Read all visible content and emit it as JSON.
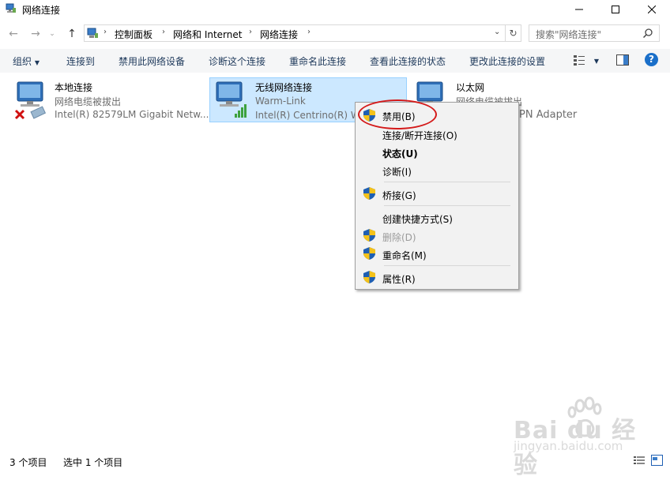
{
  "window": {
    "title": "网络连接"
  },
  "address": {
    "crumbs": [
      "控制面板",
      "网络和 Internet",
      "网络连接"
    ],
    "search_placeholder": "搜索\"网络连接\""
  },
  "toolbar": {
    "organize": "组织",
    "connect_to": "连接到",
    "disable_device": "禁用此网络设备",
    "diagnose": "诊断这个连接",
    "rename": "重命名此连接",
    "view_status": "查看此连接的状态",
    "change_settings": "更改此连接的设置"
  },
  "connections": [
    {
      "name": "本地连接",
      "status": "网络电缆被拔出",
      "adapter": "Intel(R) 82579LM Gigabit Netw..."
    },
    {
      "name": "无线网络连接",
      "status": "Warm-Link",
      "adapter": "Intel(R) Centrino(R) W"
    },
    {
      "name": "以太网",
      "status": "网络电缆被拔出",
      "adapter": "PN Adapter"
    }
  ],
  "context_menu": {
    "disable": "禁用(B)",
    "connect_disconnect": "连接/断开连接(O)",
    "status": "状态(U)",
    "diagnose": "诊断(I)",
    "bridge": "桥接(G)",
    "create_shortcut": "创建快捷方式(S)",
    "delete": "删除(D)",
    "rename": "重命名(M)",
    "properties": "属性(R)"
  },
  "statusbar": {
    "count": "3 个项目",
    "selected": "选中 1 个项目"
  },
  "watermark": {
    "brand": "Bai du 经验",
    "url": "jingyan.baidu.com"
  },
  "colors": {
    "selection": "#cce8ff",
    "annotation": "#d41a1a",
    "toolbar_text": "#1e395b"
  }
}
